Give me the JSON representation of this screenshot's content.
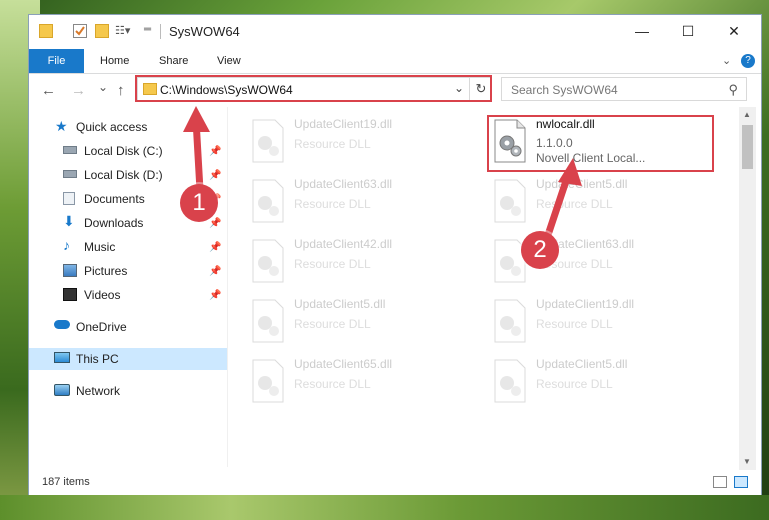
{
  "window": {
    "title": "SysWOW64",
    "minimize": "—",
    "maximize": "☐",
    "close": "✕"
  },
  "ribbon": {
    "tabs": [
      "File",
      "Home",
      "Share",
      "View"
    ],
    "expand_icon": "chevron-down-icon",
    "help_icon": "help-icon"
  },
  "nav": {
    "back": "←",
    "forward": "→",
    "recent": "⌄",
    "up": "↑",
    "address": "C:\\Windows\\SysWOW64",
    "refresh": "↻",
    "search_placeholder": "Search SysWOW64"
  },
  "sidebar": {
    "items": [
      {
        "label": "Quick access",
        "icon": "star-icon"
      },
      {
        "label": "Local Disk (C:)",
        "icon": "drive-icon",
        "pinned": true
      },
      {
        "label": "Local Disk (D:)",
        "icon": "drive-icon",
        "pinned": true
      },
      {
        "label": "Documents",
        "icon": "documents-icon",
        "pinned": true
      },
      {
        "label": "Downloads",
        "icon": "download-icon",
        "pinned": true
      },
      {
        "label": "Music",
        "icon": "music-icon",
        "pinned": true
      },
      {
        "label": "Pictures",
        "icon": "pictures-icon",
        "pinned": true
      },
      {
        "label": "Videos",
        "icon": "videos-icon",
        "pinned": true
      },
      {
        "label": "OneDrive",
        "icon": "cloud-icon"
      },
      {
        "label": "This PC",
        "icon": "computer-icon",
        "selected": true
      },
      {
        "label": "Network",
        "icon": "network-icon"
      }
    ]
  },
  "files": {
    "left_column": [
      {
        "name": "UpdateClient19.dll",
        "type": "Resource DLL"
      },
      {
        "name": "UpdateClient63.dll",
        "type": "Resource DLL"
      },
      {
        "name": "UpdateClient42.dll",
        "type": "Resource DLL"
      },
      {
        "name": "UpdateClient5.dll",
        "type": "Resource DLL"
      },
      {
        "name": "UpdateClient65.dll",
        "type": "Resource DLL"
      }
    ],
    "right_column": [
      {
        "name": "nwlocalr.dll",
        "version": "1.1.0.0",
        "type": "Novell Client Local..."
      },
      {
        "name": "UpdateClient5.dll",
        "type": "Resource DLL"
      },
      {
        "name": "UpdateClient63.dll",
        "type": "Resource DLL"
      },
      {
        "name": "UpdateClient19.dll",
        "type": "Resource DLL"
      },
      {
        "name": "UpdateClient5.dll",
        "type": "Resource DLL"
      }
    ]
  },
  "status": {
    "item_count": "187 items"
  },
  "callouts": [
    "1",
    "2"
  ],
  "colors": {
    "accent": "#1979ca",
    "highlight": "#d9424b",
    "selection": "#cce8ff"
  }
}
